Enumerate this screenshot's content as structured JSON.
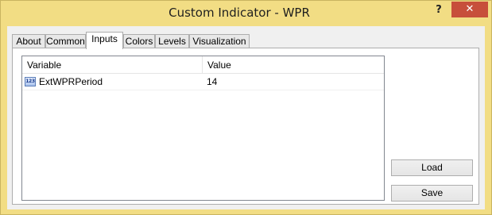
{
  "window": {
    "title": "Custom Indicator - WPR",
    "help_label": "?",
    "close_label": "✕"
  },
  "tabs": [
    {
      "label": "About"
    },
    {
      "label": "Common"
    },
    {
      "label": "Inputs",
      "active": true
    },
    {
      "label": "Colors"
    },
    {
      "label": "Levels"
    },
    {
      "label": "Visualization"
    }
  ],
  "inputs_table": {
    "columns": [
      "Variable",
      "Value"
    ],
    "rows": [
      {
        "icon": "integer-icon",
        "icon_text": "123",
        "variable": "ExtWPRPeriod",
        "value": "14"
      }
    ]
  },
  "buttons": {
    "load_label": "Load",
    "save_label": "Save"
  }
}
